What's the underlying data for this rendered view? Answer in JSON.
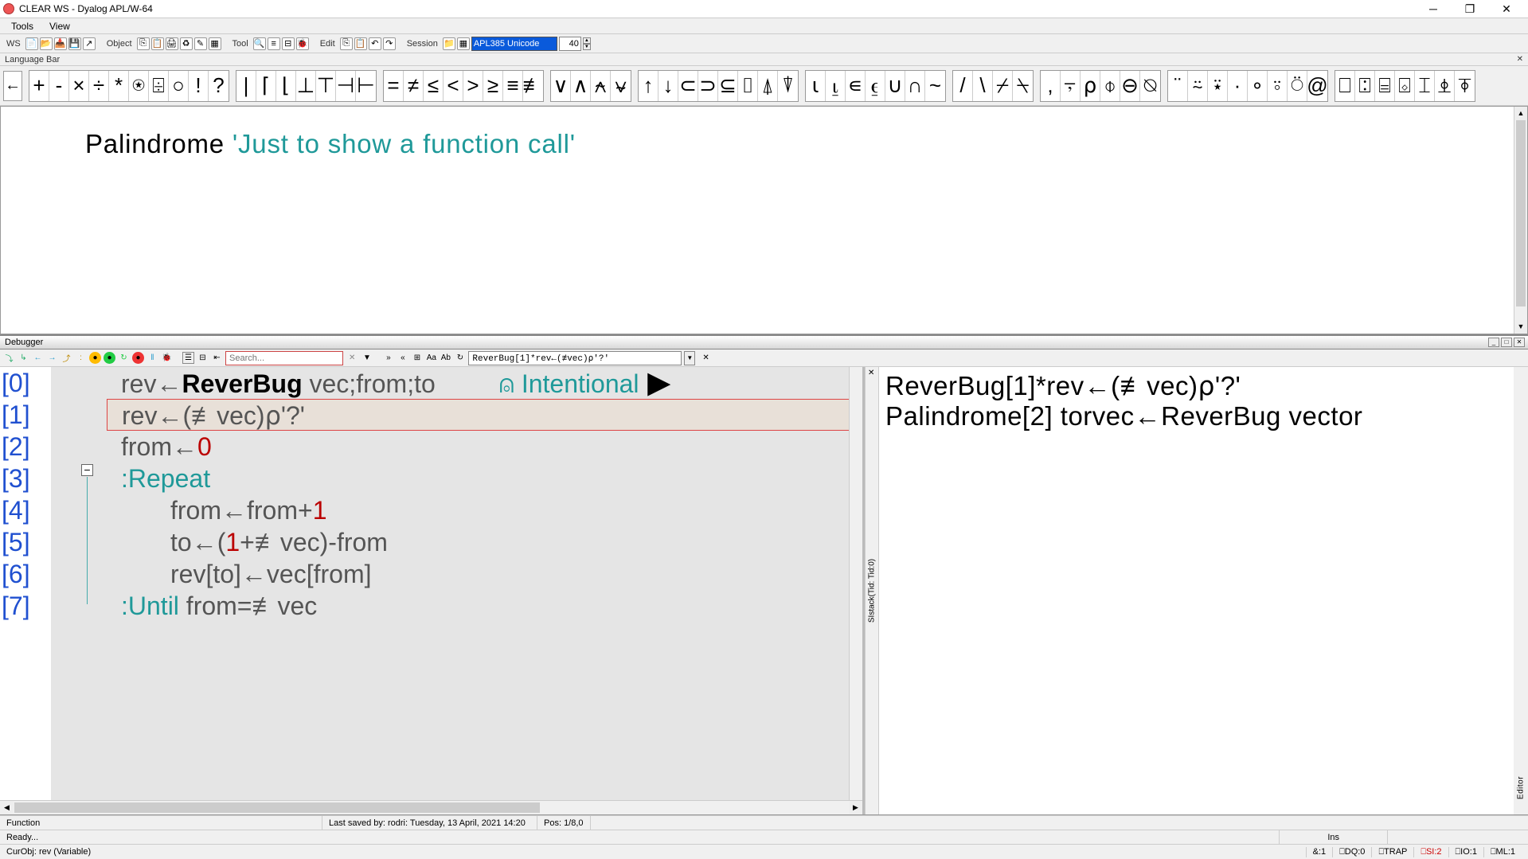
{
  "window": {
    "title": "CLEAR WS - Dyalog APL/W-64"
  },
  "menus": {
    "tools": "Tools",
    "view": "View"
  },
  "toolbar": {
    "ws": "WS",
    "object": "Object",
    "tool": "Tool",
    "edit": "Edit",
    "session": "Session",
    "font_name": "APL385 Unicode",
    "font_size": "40"
  },
  "langbar_label": "Language Bar",
  "glyph_groups": [
    [
      "+",
      "-",
      "×",
      "÷",
      "*",
      "⍟",
      "⌹",
      "○",
      "!",
      "?"
    ],
    [
      "|",
      "⌈",
      "⌊",
      "⊥",
      "⊤",
      "⊣",
      "⊢"
    ],
    [
      "=",
      "≠",
      "≤",
      "<",
      ">",
      "≥",
      "≡",
      "≢"
    ],
    [
      "∨",
      "∧",
      "⍲",
      "⍱"
    ],
    [
      "↑",
      "↓",
      "⊂",
      "⊃",
      "⊆",
      "⌷",
      "⍋",
      "⍒"
    ],
    [
      "⍳",
      "⍸",
      "∊",
      "⍷",
      "∪",
      "∩",
      "~"
    ],
    [
      "/",
      "\\",
      "⌿",
      "⍀"
    ],
    [
      ",",
      "⍪",
      "⍴",
      "⌽",
      "⊖",
      "⍉"
    ],
    [
      "¨",
      "⍨",
      "⍣",
      "·",
      "∘",
      "⍤",
      "⍥",
      "@"
    ],
    [
      "⎕",
      "⍠",
      "⌸",
      "⌺",
      "⌶",
      "⍎",
      "⍕"
    ]
  ],
  "session": {
    "line_fn": "Palindrome ",
    "line_str": "'Just to show a function call'"
  },
  "debugger": {
    "title": "Debugger",
    "search_placeholder": "Search...",
    "location": "ReverBug[1]*rev←(≢vec)⍴'?'",
    "gutter": [
      "[0]",
      "[1]",
      "[2]",
      "[3]",
      "[4]",
      "[5]",
      "[6]",
      "[7]"
    ],
    "line0": {
      "a": "rev←",
      "fn": "ReverBug",
      "b": " vec;from;to",
      "c": "⍝ Intentional"
    },
    "line1": "rev←(≢vec)⍴'?'",
    "line2": {
      "a": "from←",
      "n": "0"
    },
    "line3": ":Repeat",
    "line4": {
      "a": "from←from+",
      "n": "1"
    },
    "line5": {
      "a": "to←(",
      "n": "1",
      "b": "+≢vec)-from"
    },
    "line6": "rev[to]←vec[from]",
    "line7": {
      "a": ":Until",
      "b": " from=≢vec"
    },
    "status_fn": "Function",
    "status_saved": "Last saved by: rodri: Tuesday, 13 April, 2021 14:20",
    "status_pos": "Pos: 1/8,0"
  },
  "sistack": {
    "l1": "ReverBug[1]*rev←(≢vec)⍴'?'",
    "l2": "Palindrome[2] torvec←ReverBug vector",
    "side_label": "SIstack(Tid: Tid:0)",
    "edit_label": "Editor"
  },
  "status1": {
    "ready": "Ready...",
    "ins": "Ins"
  },
  "status2": {
    "curobj": "CurObj: rev (Variable)",
    "flags": [
      "&:1",
      "⎕DQ:0",
      "⎕TRAP",
      "⎕SI:2",
      "⎕IO:1",
      "⎕ML:1"
    ]
  }
}
